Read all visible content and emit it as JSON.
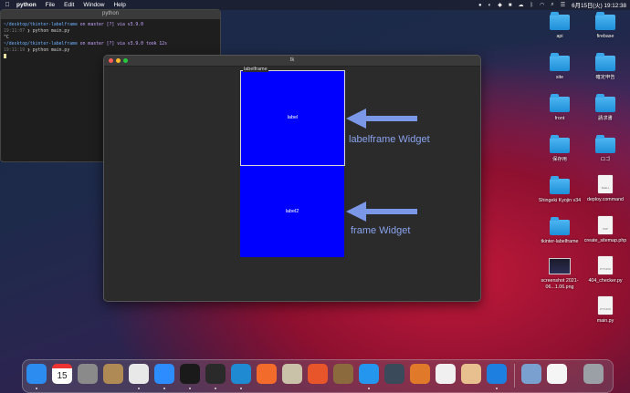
{
  "menubar": {
    "app_name": "python",
    "menus": [
      "File",
      "Edit",
      "Window",
      "Help"
    ],
    "datetime": "6月15日(火)  19:12:38"
  },
  "terminal": {
    "title": "python",
    "lines": {
      "l1_path": "~/desktop/tkinter-labelframe",
      "l1_rest": " on  master [?] via  v3.9.0",
      "l2_time": "19:11:07",
      "l2_cmd": " ❯ python main.py",
      "l3": "^C",
      "l4_path": "~/desktop/tkinter-labelframe",
      "l4_rest": " on  master [?] via  v3.9.0 took 12s",
      "l5_time": "19:11:19",
      "l5_cmd": " ❯ python main.py"
    }
  },
  "tk_window": {
    "title": "tk",
    "labelframe_caption": "labelframe",
    "label_text": "label",
    "label2_text": "label2",
    "annotation_1": "labelframe Widget",
    "annotation_2": "frame Widget",
    "colors": {
      "widget_bg": "#0000ff",
      "annotation": "#8aa3ee"
    }
  },
  "desktop": {
    "icons": [
      {
        "label": "api",
        "kind": "folder"
      },
      {
        "label": "firebase",
        "kind": "folder"
      },
      {
        "label": "site",
        "kind": "folder"
      },
      {
        "label": "確定申告",
        "kind": "folder"
      },
      {
        "label": "front",
        "kind": "folder"
      },
      {
        "label": "請求書",
        "kind": "folder"
      },
      {
        "label": "保存用",
        "kind": "folder"
      },
      {
        "label": "ロゴ",
        "kind": "folder"
      },
      {
        "label": "Shingeki Kyojin v34",
        "kind": "folder"
      },
      {
        "label": "deploy.command",
        "kind": "doc",
        "badge": "SHELL"
      },
      {
        "label": "tkinter-labelframe",
        "kind": "folder"
      },
      {
        "label": "create_sitemap.php",
        "kind": "doc",
        "badge": "PHP"
      },
      {
        "label": "screenshot 2021-06...1.06.png",
        "kind": "image"
      },
      {
        "label": "404_checker.py",
        "kind": "doc",
        "badge": "PYTHON"
      },
      {
        "label": "main.py",
        "kind": "doc",
        "badge": "PYTHON"
      }
    ]
  },
  "dock": {
    "apps": [
      {
        "name": "finder-icon",
        "color": "#2d8cf0"
      },
      {
        "name": "calendar-icon",
        "color": "#ffffff",
        "text": "15"
      },
      {
        "name": "system-preferences-icon",
        "color": "#8a8a8a"
      },
      {
        "name": "contacts-icon",
        "color": "#b08a55"
      },
      {
        "name": "chrome-icon",
        "color": "#e8e8e8"
      },
      {
        "name": "zoom-icon",
        "color": "#2d8cff"
      },
      {
        "name": "terminal-icon",
        "color": "#1a1a1a"
      },
      {
        "name": "terminal2-icon",
        "color": "#2a2a2a"
      },
      {
        "name": "vscode-icon",
        "color": "#1f8ad2"
      },
      {
        "name": "safari-icon",
        "color": "#f36b2a"
      },
      {
        "name": "sequel-icon",
        "color": "#c9c2a8"
      },
      {
        "name": "activity-icon",
        "color": "#e8552a"
      },
      {
        "name": "archive-icon",
        "color": "#8b6b3e"
      },
      {
        "name": "docker-icon",
        "color": "#2496ed"
      },
      {
        "name": "quicktime-icon",
        "color": "#3a4a5a"
      },
      {
        "name": "sourcetree-icon",
        "color": "#e07a2a"
      },
      {
        "name": "vpn-icon",
        "color": "#f0f0f0"
      },
      {
        "name": "preview-icon",
        "color": "#e8c090"
      },
      {
        "name": "infinity-icon",
        "color": "#1d7fe0"
      },
      {
        "name": "folder-stack-icon",
        "color": "#7aa0d0"
      },
      {
        "name": "document-icon",
        "color": "#f5f5f5"
      },
      {
        "name": "trash-icon",
        "color": "#9aa0a6"
      }
    ]
  }
}
